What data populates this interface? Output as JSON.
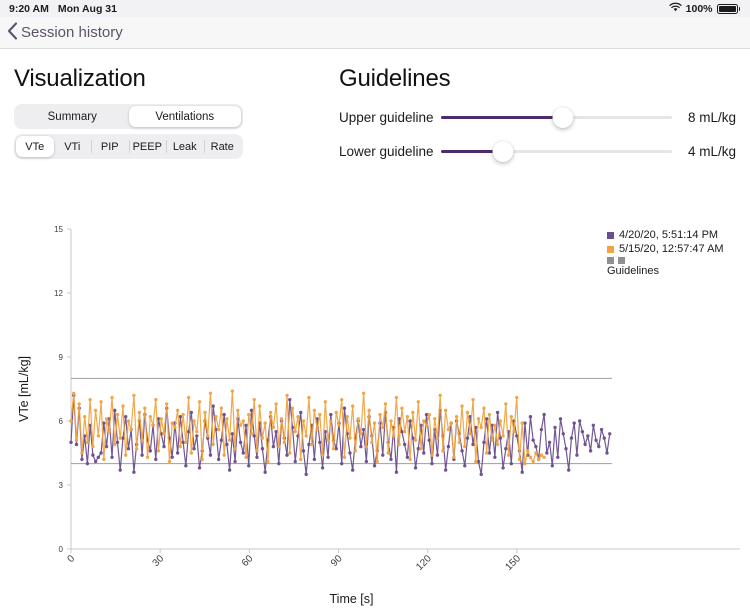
{
  "status_bar": {
    "time": "9:20 AM",
    "date": "Mon Aug 31",
    "wifi_icon": "wifi-icon",
    "battery_percent": "100%",
    "battery_icon": "battery-full-icon"
  },
  "nav": {
    "back_icon": "chevron-left-icon",
    "back_label": "Session history"
  },
  "visualization": {
    "title": "Visualization",
    "view_tabs": [
      {
        "label": "Summary",
        "selected": false
      },
      {
        "label": "Ventilations",
        "selected": true
      }
    ],
    "metric_tabs": [
      {
        "label": "VTe",
        "selected": true
      },
      {
        "label": "VTi",
        "selected": false
      },
      {
        "label": "PIP",
        "selected": false
      },
      {
        "label": "PEEP",
        "selected": false
      },
      {
        "label": "Leak",
        "selected": false
      },
      {
        "label": "Rate",
        "selected": false
      }
    ]
  },
  "guidelines": {
    "title": "Guidelines",
    "sliders": [
      {
        "label": "Upper guideline",
        "value": "8 mL/kg",
        "percent": 53
      },
      {
        "label": "Lower guideline",
        "value": "4 mL/kg",
        "percent": 27
      }
    ]
  },
  "legend": {
    "items": [
      {
        "label": "4/20/20, 5:51:14 PM",
        "color": "#6b4e8e"
      },
      {
        "label": "5/15/20, 12:57:47 AM",
        "color": "#f0a340"
      }
    ],
    "guidelines_label": "Guidelines",
    "guideline_colors": [
      "#8e8e93",
      "#8e8e93"
    ]
  },
  "chart_data": {
    "type": "line",
    "title": "",
    "xlabel": "Time [s]",
    "ylabel": "VTe [mL/kg]",
    "xlim": [
      0,
      182
    ],
    "ylim": [
      0,
      15
    ],
    "xticks": [
      0,
      30,
      60,
      90,
      120,
      150
    ],
    "yticks": [
      0,
      3,
      6,
      9,
      12,
      15
    ],
    "xtick_rotation": 45,
    "grid": false,
    "markers": "circle",
    "guideline_lines": [
      {
        "name": "Upper guideline",
        "y": 8,
        "color": "#8e8e93"
      },
      {
        "name": "Lower guideline",
        "y": 4,
        "color": "#8e8e93"
      }
    ],
    "series": [
      {
        "name": "4/20/20, 5:51:14 PM",
        "color": "#6b4e8e",
        "x_start": 0,
        "x_step": 0.92,
        "values": [
          5.0,
          7.2,
          4.9,
          6.6,
          4.2,
          5.3,
          4.0,
          5.8,
          4.4,
          4.1,
          4.3,
          4.5,
          5.9,
          4.8,
          6.1,
          4.3,
          6.5,
          5.0,
          3.7,
          5.2,
          6.2,
          4.7,
          5.6,
          3.6,
          4.9,
          6.0,
          4.4,
          6.3,
          5.1,
          4.6,
          5.8,
          4.2,
          6.1,
          5.4,
          4.8,
          6.6,
          5.2,
          4.3,
          5.9,
          4.5,
          6.2,
          5.0,
          3.9,
          5.5,
          6.4,
          4.7,
          5.3,
          3.8,
          4.6,
          6.0,
          5.2,
          4.4,
          6.7,
          5.6,
          4.2,
          5.1,
          6.3,
          4.9,
          3.7,
          5.4,
          4.1,
          6.1,
          5.0,
          4.5,
          5.8,
          3.9,
          6.5,
          5.3,
          4.3,
          5.9,
          4.7,
          3.6,
          5.1,
          6.2,
          4.8,
          5.5,
          4.0,
          6.0,
          5.2,
          4.4,
          7.0,
          5.7,
          4.1,
          5.3,
          6.4,
          4.6,
          3.5,
          4.9,
          5.8,
          4.2,
          6.1,
          5.0,
          3.8,
          5.5,
          4.3,
          6.3,
          5.1,
          4.7,
          5.9,
          4.0,
          6.6,
          5.4,
          4.5,
          3.7,
          5.2,
          6.0,
          4.8,
          5.6,
          4.1,
          6.2,
          5.3,
          3.9,
          4.6,
          5.9,
          4.4,
          6.4,
          5.0,
          4.2,
          5.7,
          3.6,
          6.1,
          5.5,
          4.9,
          4.3,
          6.0,
          5.2,
          3.8,
          4.7,
          5.8,
          4.5,
          6.3,
          5.1,
          4.0,
          5.6,
          4.4,
          6.5,
          5.3,
          3.7,
          4.8,
          5.9,
          4.2,
          6.0,
          5.4,
          4.6,
          3.9,
          5.2,
          6.2,
          4.9,
          5.7,
          4.1,
          3.5,
          5.0,
          6.1,
          4.5,
          5.8,
          4.3,
          6.4,
          5.2,
          3.8,
          4.7,
          5.5,
          4.0,
          6.0,
          5.3,
          4.6,
          3.6,
          5.9,
          4.4,
          6.2,
          5.1,
          4.8,
          4.2,
          5.6,
          6.3,
          4.5,
          5.0,
          3.9,
          5.7,
          4.3,
          6.1,
          5.4,
          4.7,
          3.7,
          5.2,
          5.9,
          4.4,
          6.0,
          5.5,
          4.9,
          5.3,
          4.6,
          5.8,
          5.1,
          4.8,
          5.6,
          5.2,
          4.5,
          5.4
        ]
      },
      {
        "name": "5/15/20, 12:57:47 AM",
        "color": "#f0a340",
        "x_start": 0,
        "x_step": 0.92,
        "values": [
          6.0,
          7.3,
          5.1,
          6.8,
          4.5,
          6.2,
          5.0,
          7.0,
          4.8,
          6.5,
          5.3,
          6.9,
          4.2,
          6.1,
          5.5,
          7.1,
          4.9,
          6.3,
          5.2,
          6.7,
          4.4,
          6.0,
          5.6,
          7.2,
          4.7,
          6.4,
          5.1,
          6.6,
          4.3,
          6.2,
          5.8,
          7.0,
          4.6,
          6.1,
          5.4,
          6.8,
          4.1,
          5.9,
          5.7,
          6.5,
          4.8,
          6.3,
          5.0,
          7.1,
          4.5,
          6.0,
          5.5,
          6.9,
          4.2,
          6.4,
          5.3,
          7.3,
          4.9,
          6.2,
          5.6,
          6.6,
          4.4,
          6.1,
          5.1,
          7.4,
          4.7,
          6.5,
          5.8,
          6.0,
          4.3,
          6.3,
          5.4,
          7.0,
          4.6,
          6.7,
          5.2,
          5.9,
          4.1,
          6.4,
          5.7,
          6.8,
          4.8,
          6.1,
          5.0,
          7.2,
          4.5,
          6.6,
          5.5,
          6.2,
          4.2,
          6.0,
          5.3,
          7.1,
          4.9,
          6.5,
          5.6,
          6.3,
          4.4,
          6.9,
          5.1,
          6.0,
          4.7,
          6.4,
          5.8,
          7.0,
          4.3,
          6.2,
          5.2,
          6.7,
          4.6,
          6.1,
          5.4,
          7.3,
          4.8,
          6.5,
          5.0,
          5.9,
          4.1,
          6.3,
          5.7,
          6.8,
          4.5,
          6.0,
          5.3,
          7.1,
          4.9,
          6.6,
          5.5,
          6.2,
          4.2,
          6.4,
          5.1,
          6.9,
          4.7,
          6.0,
          5.8,
          6.3,
          4.4,
          6.1,
          5.2,
          7.2,
          4.6,
          6.5,
          5.6,
          5.9,
          4.3,
          6.2,
          5.0,
          6.7,
          4.8,
          6.4,
          5.4,
          7.0,
          4.1,
          6.1,
          5.7,
          6.6,
          4.5,
          6.3,
          5.1,
          5.8,
          4.9,
          6.0,
          5.3,
          6.8,
          4.4,
          6.2,
          5.5,
          7.1,
          4.2,
          5.9,
          4.0,
          4.6,
          4.3,
          4.1,
          4.5,
          4.2,
          4.4,
          4.3
        ]
      }
    ]
  }
}
